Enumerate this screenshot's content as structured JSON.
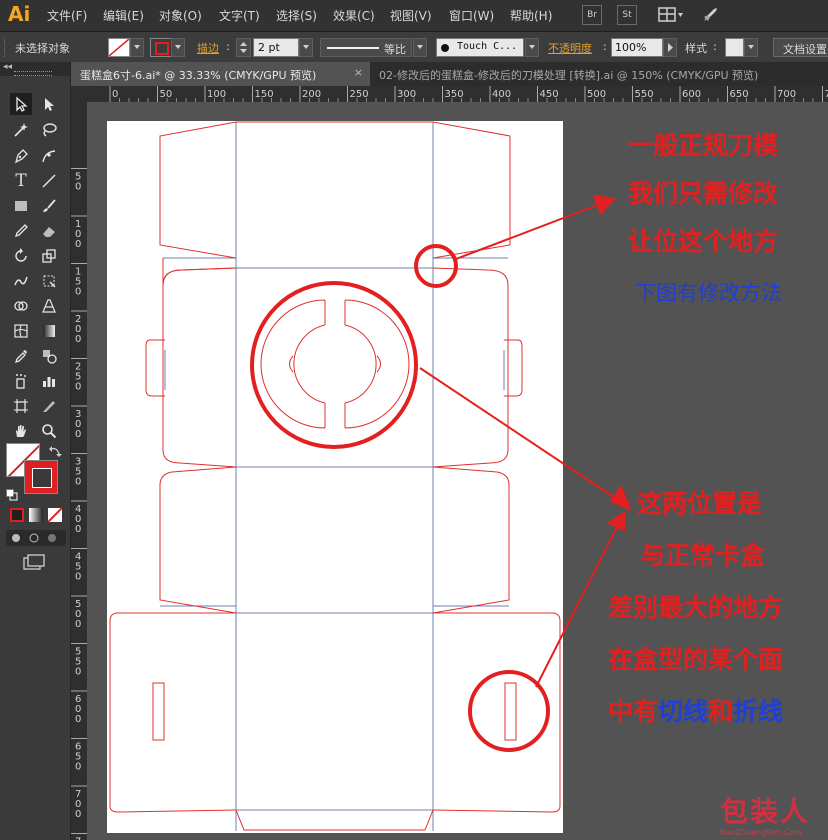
{
  "app": {
    "logo": "Ai"
  },
  "menu": [
    "文件(F)",
    "编辑(E)",
    "对象(O)",
    "文字(T)",
    "选择(S)",
    "效果(C)",
    "视图(V)",
    "窗口(W)",
    "帮助(H)"
  ],
  "menu_buttons": {
    "bridge": "Br",
    "stock": "St"
  },
  "control": {
    "selection_status": "未选择对象",
    "stroke_label": "描边",
    "stroke_weight": "2 pt",
    "profile": "等比",
    "brush": "Touch C...",
    "opacity_label": "不透明度",
    "opacity": "100%",
    "style_label": "样式",
    "doc_setup": "文档设置"
  },
  "tabs": [
    {
      "label": "蛋糕盒6寸-6.ai* @ 33.33% (CMYK/GPU 预览)",
      "close": "×"
    },
    {
      "label": "02-修改后的蛋糕盒-修改后的刀模处理 [转换].ai @ 150% (CMYK/GPU 预览)"
    }
  ],
  "ruler": {
    "h_ticks": [
      "0",
      "50",
      "100",
      "150",
      "200",
      "250",
      "300",
      "350",
      "400",
      "450",
      "500",
      "550",
      "600",
      "650",
      "700",
      "750"
    ],
    "v_ticks": [
      "50",
      "100",
      "150",
      "200",
      "250",
      "300",
      "350",
      "400",
      "450",
      "500",
      "550",
      "600",
      "650",
      "700",
      "750"
    ]
  },
  "annotations": {
    "note1": [
      "一般正规刀模",
      "我们只需修改",
      "让位这个地方"
    ],
    "note1_blue": "下图有修改方法",
    "note2": [
      "这两位置是",
      "与正常卡盒",
      "差别最大的地方",
      "在盒型的某个面"
    ],
    "note2_last": {
      "a": "中有",
      "b": "切线",
      "c": "和",
      "d": "折线"
    }
  },
  "watermark": {
    "main": "包装人",
    "sub": "BaoZhuangRen.Com"
  },
  "colors": {
    "cut_line": "#e0302e",
    "fold_line": "#6e7fa8",
    "annotation_red": "#e3201f",
    "annotation_blue": "#1f3fd8",
    "accent": "#f5a623"
  }
}
